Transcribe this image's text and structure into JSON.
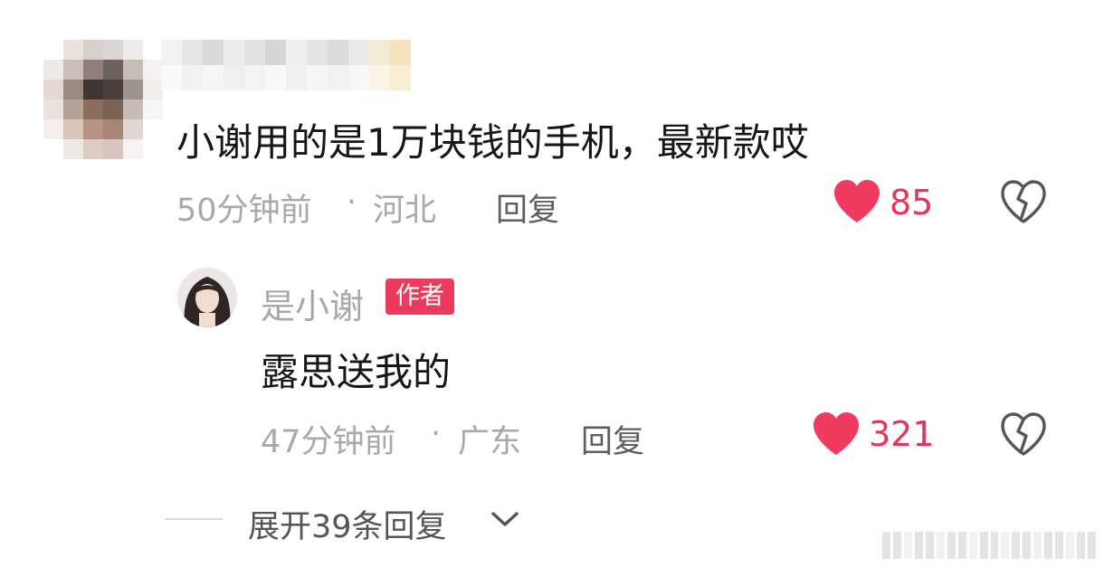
{
  "comment": {
    "text": "小谢用的是1万块钱的手机，最新款哎",
    "time": "50分钟前",
    "separator": "·",
    "location": "河北",
    "reply_label": "回复",
    "like_count": "85"
  },
  "reply": {
    "author": "是小谢",
    "badge": "作者",
    "text": "露思送我的",
    "time": "47分钟前",
    "separator": "·",
    "location": "广东",
    "reply_label": "回复",
    "like_count": "321"
  },
  "expand": {
    "label": "展开39条回复"
  },
  "colors": {
    "like_red": "#f03a5f",
    "badge_red": "#ea3b5c"
  },
  "icons": [
    "heart-icon",
    "broken-heart-icon",
    "chevron-down-icon"
  ]
}
